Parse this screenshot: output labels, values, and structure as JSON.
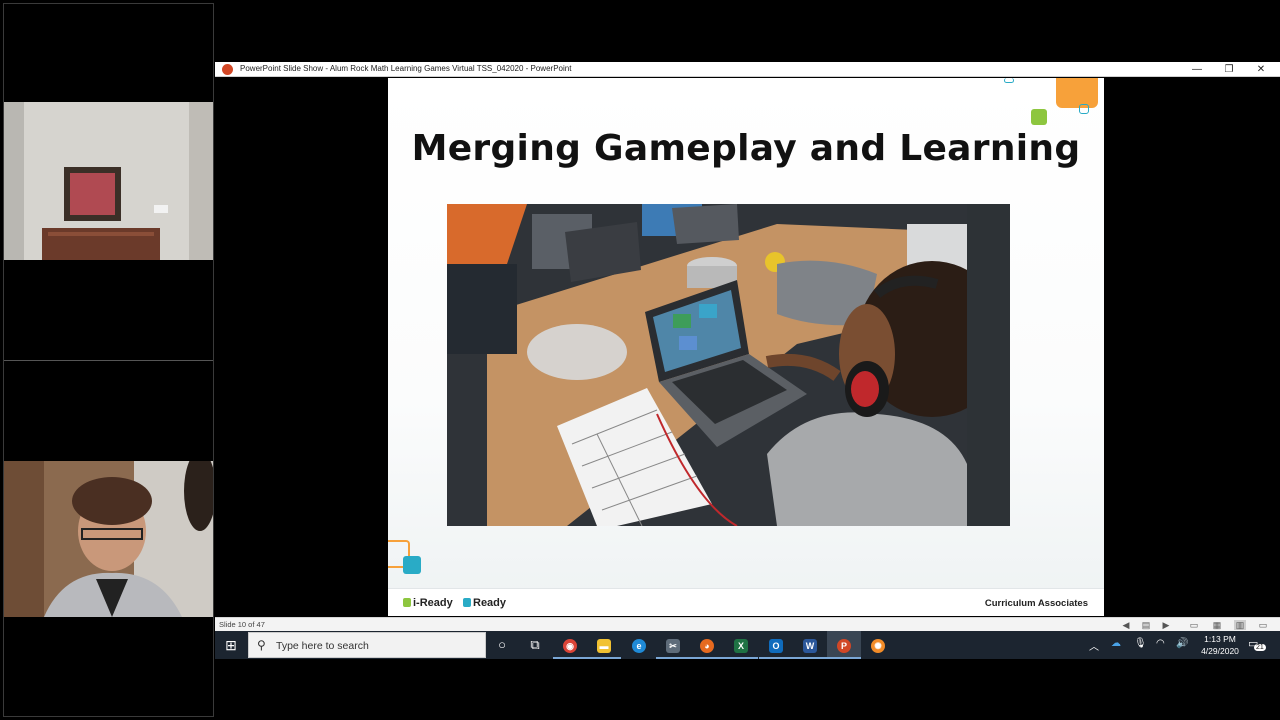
{
  "window": {
    "title": "PowerPoint Slide Show  -  Alum Rock Math Learning Games Virtual TSS_042020  -  PowerPoint",
    "minimize_glyph": "—",
    "restore_glyph": "❐",
    "close_glyph": "✕"
  },
  "slide": {
    "title": "Merging Gameplay and Learning",
    "footer_logo_1": "i-Ready",
    "footer_logo_2": "Ready",
    "footer_brand": "Curriculum Associates"
  },
  "status_bar": {
    "slide_counter": "Slide 10 of 47"
  },
  "taskbar": {
    "search_placeholder": "Type here to search",
    "apps": [
      {
        "name": "cortana",
        "glyph": "○"
      },
      {
        "name": "task-view",
        "glyph": "⧉"
      },
      {
        "name": "chrome",
        "glyph": "◉"
      },
      {
        "name": "file-explorer",
        "glyph": "▬"
      },
      {
        "name": "edge",
        "glyph": "e"
      },
      {
        "name": "snipping-tool",
        "glyph": "✂"
      },
      {
        "name": "firefox",
        "glyph": "◕"
      },
      {
        "name": "excel",
        "glyph": "X"
      },
      {
        "name": "outlook",
        "glyph": "O"
      },
      {
        "name": "word",
        "glyph": "W"
      },
      {
        "name": "powerpoint",
        "glyph": "P"
      },
      {
        "name": "zoom-app",
        "glyph": "✺"
      }
    ],
    "time": "1:13 PM",
    "date": "4/29/2020",
    "notification_count": "21"
  },
  "colors": {
    "accent_orange": "#f7a13a",
    "accent_green": "#8dc63f",
    "accent_teal": "#29abc6",
    "taskbar_bg": "#1c2530"
  }
}
